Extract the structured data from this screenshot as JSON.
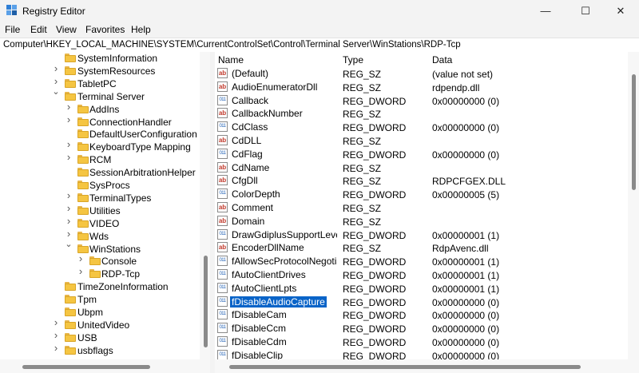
{
  "window": {
    "title": "Registry Editor",
    "minimize_glyph": "—",
    "maximize_glyph": "☐",
    "close_glyph": "✕"
  },
  "menu": [
    "File",
    "Edit",
    "View",
    "Favorites",
    "Help"
  ],
  "address": "Computer\\HKEY_LOCAL_MACHINE\\SYSTEM\\CurrentControlSet\\Control\\Terminal Server\\WinStations\\RDP-Tcp",
  "tree": [
    {
      "label": "SystemInformation",
      "level": 1,
      "arrow": ""
    },
    {
      "label": "SystemResources",
      "level": 1,
      "arrow": ">"
    },
    {
      "label": "TabletPC",
      "level": 1,
      "arrow": ">"
    },
    {
      "label": "Terminal Server",
      "level": 1,
      "arrow": "v"
    },
    {
      "label": "AddIns",
      "level": 2,
      "arrow": ">"
    },
    {
      "label": "ConnectionHandler",
      "level": 2,
      "arrow": ">"
    },
    {
      "label": "DefaultUserConfiguration",
      "level": 2,
      "arrow": ""
    },
    {
      "label": "KeyboardType Mapping",
      "level": 2,
      "arrow": ">"
    },
    {
      "label": "RCM",
      "level": 2,
      "arrow": ">"
    },
    {
      "label": "SessionArbitrationHelper",
      "level": 2,
      "arrow": ""
    },
    {
      "label": "SysProcs",
      "level": 2,
      "arrow": ""
    },
    {
      "label": "TerminalTypes",
      "level": 2,
      "arrow": ">"
    },
    {
      "label": "Utilities",
      "level": 2,
      "arrow": ">"
    },
    {
      "label": "VIDEO",
      "level": 2,
      "arrow": ">"
    },
    {
      "label": "Wds",
      "level": 2,
      "arrow": ">"
    },
    {
      "label": "WinStations",
      "level": 2,
      "arrow": "v"
    },
    {
      "label": "Console",
      "level": 3,
      "arrow": ">"
    },
    {
      "label": "RDP-Tcp",
      "level": 3,
      "arrow": ">"
    },
    {
      "label": "TimeZoneInformation",
      "level": 1,
      "arrow": ""
    },
    {
      "label": "Tpm",
      "level": 1,
      "arrow": ""
    },
    {
      "label": "Ubpm",
      "level": 1,
      "arrow": ""
    },
    {
      "label": "UnitedVideo",
      "level": 1,
      "arrow": ">"
    },
    {
      "label": "USB",
      "level": 1,
      "arrow": ">"
    },
    {
      "label": "usbflags",
      "level": 1,
      "arrow": ">"
    }
  ],
  "columns": {
    "name": "Name",
    "type": "Type",
    "data": "Data"
  },
  "values": [
    {
      "icon": "ab",
      "name": "(Default)",
      "type": "REG_SZ",
      "data": "(value not set)"
    },
    {
      "icon": "ab",
      "name": "AudioEnumeratorDll",
      "type": "REG_SZ",
      "data": "rdpendp.dll"
    },
    {
      "icon": "011",
      "name": "Callback",
      "type": "REG_DWORD",
      "data": "0x00000000 (0)"
    },
    {
      "icon": "ab",
      "name": "CallbackNumber",
      "type": "REG_SZ",
      "data": ""
    },
    {
      "icon": "011",
      "name": "CdClass",
      "type": "REG_DWORD",
      "data": "0x00000000 (0)"
    },
    {
      "icon": "ab",
      "name": "CdDLL",
      "type": "REG_SZ",
      "data": ""
    },
    {
      "icon": "011",
      "name": "CdFlag",
      "type": "REG_DWORD",
      "data": "0x00000000 (0)"
    },
    {
      "icon": "ab",
      "name": "CdName",
      "type": "REG_SZ",
      "data": ""
    },
    {
      "icon": "ab",
      "name": "CfgDll",
      "type": "REG_SZ",
      "data": "RDPCFGEX.DLL"
    },
    {
      "icon": "011",
      "name": "ColorDepth",
      "type": "REG_DWORD",
      "data": "0x00000005 (5)"
    },
    {
      "icon": "ab",
      "name": "Comment",
      "type": "REG_SZ",
      "data": ""
    },
    {
      "icon": "ab",
      "name": "Domain",
      "type": "REG_SZ",
      "data": ""
    },
    {
      "icon": "011",
      "name": "DrawGdiplusSupportLevel",
      "type": "REG_DWORD",
      "data": "0x00000001 (1)"
    },
    {
      "icon": "ab",
      "name": "EncoderDllName",
      "type": "REG_SZ",
      "data": "RdpAvenc.dll"
    },
    {
      "icon": "011",
      "name": "fAllowSecProtocolNegotia",
      "type": "REG_DWORD",
      "data": "0x00000001 (1)"
    },
    {
      "icon": "011",
      "name": "fAutoClientDrives",
      "type": "REG_DWORD",
      "data": "0x00000001 (1)"
    },
    {
      "icon": "011",
      "name": "fAutoClientLpts",
      "type": "REG_DWORD",
      "data": "0x00000001 (1)"
    },
    {
      "icon": "011",
      "name": "fDisableAudioCapture",
      "type": "REG_DWORD",
      "data": "0x00000000 (0)",
      "selected": true
    },
    {
      "icon": "011",
      "name": "fDisableCam",
      "type": "REG_DWORD",
      "data": "0x00000000 (0)"
    },
    {
      "icon": "011",
      "name": "fDisableCcm",
      "type": "REG_DWORD",
      "data": "0x00000000 (0)"
    },
    {
      "icon": "011",
      "name": "fDisableCdm",
      "type": "REG_DWORD",
      "data": "0x00000000 (0)"
    },
    {
      "icon": "011",
      "name": "fDisableClip",
      "type": "REG_DWORD",
      "data": "0x00000000 (0)"
    }
  ]
}
